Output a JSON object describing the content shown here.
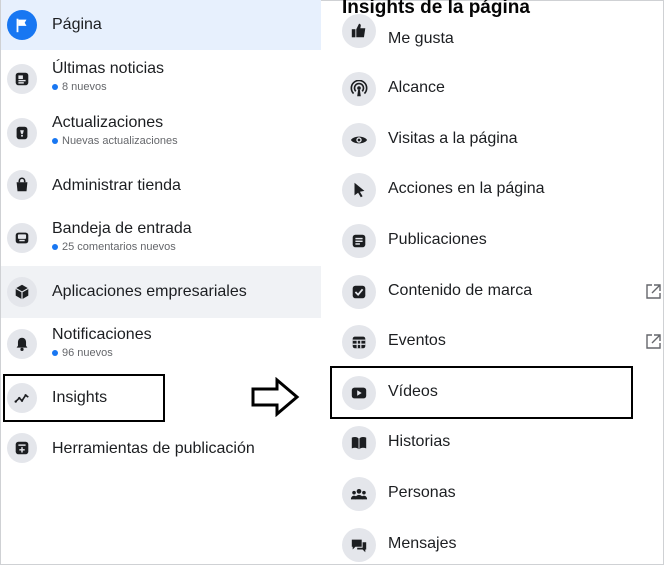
{
  "left_menu": {
    "items": [
      {
        "label": "Página",
        "sub": ""
      },
      {
        "label": "Últimas noticias",
        "sub": "8 nuevos"
      },
      {
        "label": "Actualizaciones",
        "sub": "Nuevas actualizaciones"
      },
      {
        "label": "Administrar tienda",
        "sub": ""
      },
      {
        "label": "Bandeja de entrada",
        "sub": "25 comentarios nuevos"
      },
      {
        "label": "Aplicaciones empresariales",
        "sub": ""
      },
      {
        "label": "Notificaciones",
        "sub": "96 nuevos"
      },
      {
        "label": "Insights",
        "sub": ""
      },
      {
        "label": "Herramientas de publicación",
        "sub": ""
      }
    ]
  },
  "insights_panel": {
    "title": "Insights de la página",
    "items": [
      {
        "label": "Me gusta"
      },
      {
        "label": "Alcance"
      },
      {
        "label": "Visitas a la página"
      },
      {
        "label": "Acciones en la página"
      },
      {
        "label": "Publicaciones"
      },
      {
        "label": "Contenido de marca"
      },
      {
        "label": "Eventos"
      },
      {
        "label": "Vídeos"
      },
      {
        "label": "Historias"
      },
      {
        "label": "Personas"
      },
      {
        "label": "Mensajes"
      }
    ]
  },
  "colors": {
    "accent": "#1877f2",
    "selected_bg": "#e7f0fd",
    "icon_bg": "#e4e6eb",
    "highlight_border": "#000000"
  }
}
